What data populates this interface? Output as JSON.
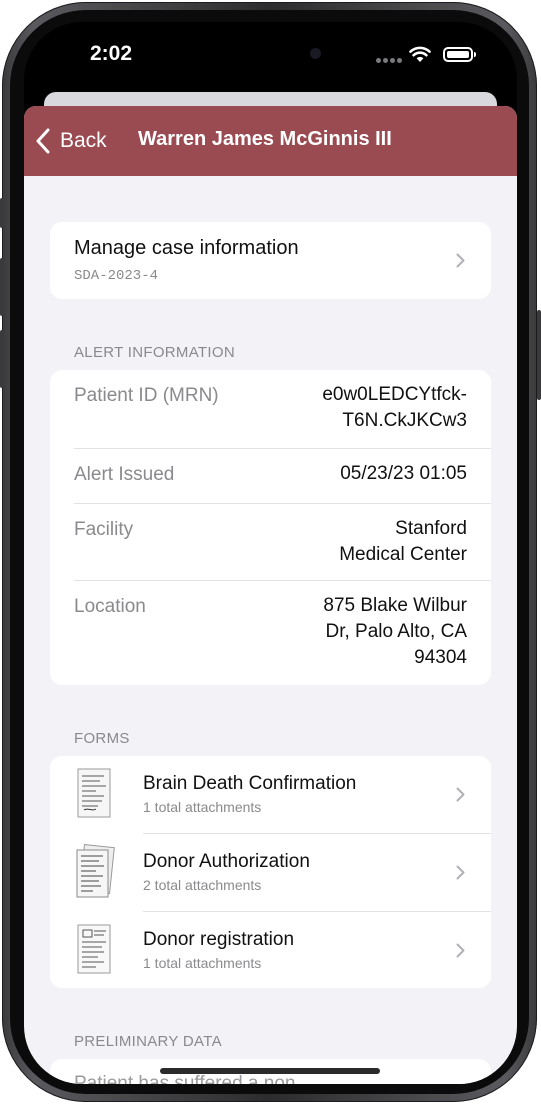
{
  "status_bar": {
    "time": "2:02"
  },
  "nav": {
    "back_label": "Back",
    "title": "Warren James McGinnis III"
  },
  "manage": {
    "title": "Manage case information",
    "case_id": "SDA-2023-4"
  },
  "alert": {
    "header": "ALERT INFORMATION",
    "rows": [
      {
        "label": "Patient ID (MRN)",
        "value_line1": "e0w0LEDCYtfck-",
        "value_line2": "T6N.CkJKCw3"
      },
      {
        "label": "Alert Issued",
        "value_line1": "05/23/23 01:05"
      },
      {
        "label": "Facility",
        "value_line1": "Stanford",
        "value_line2": "Medical Center"
      },
      {
        "label": "Location",
        "value_line1": "875 Blake Wilbur",
        "value_line2": "Dr, Palo Alto, CA",
        "value_line3": "94304"
      }
    ]
  },
  "forms": {
    "header": "FORMS",
    "items": [
      {
        "title": "Brain Death Confirmation",
        "subtitle": "1 total attachments"
      },
      {
        "title": "Donor Authorization",
        "subtitle": "2 total attachments"
      },
      {
        "title": "Donor registration",
        "subtitle": "1 total attachments"
      }
    ]
  },
  "preliminary": {
    "header": "PRELIMINARY DATA",
    "partial_text": "Patient has suffered a non"
  },
  "colors": {
    "nav_background": "#9a4b52",
    "page_background": "#f2f2f7",
    "card_background": "#ffffff"
  },
  "icons": [
    "back-chevron-icon",
    "chevron-right-icon",
    "wifi-icon",
    "battery-icon",
    "signal-icon",
    "document-thumbnail-icon"
  ]
}
